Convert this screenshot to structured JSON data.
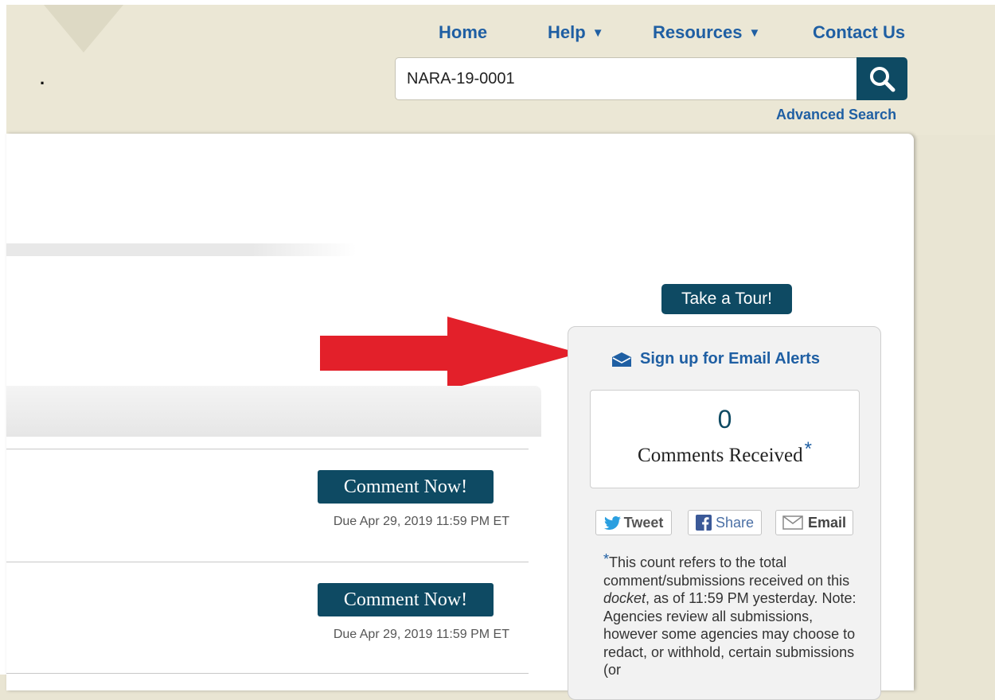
{
  "header": {
    "nav": [
      {
        "label": "Home",
        "dropdown": false
      },
      {
        "label": "Help",
        "dropdown": true
      },
      {
        "label": "Resources",
        "dropdown": true
      },
      {
        "label": "Contact Us",
        "dropdown": false
      }
    ],
    "logo_text": ".",
    "search": {
      "value": "NARA-19-0001",
      "icon": "search-icon"
    },
    "advanced_search": "Advanced Search"
  },
  "main": {
    "comments": [
      {
        "button": "Comment Now!",
        "due": "Due Apr 29, 2019 11:59 PM ET"
      },
      {
        "button": "Comment Now!",
        "due": "Due Apr 29, 2019 11:59 PM ET"
      }
    ]
  },
  "sidebar": {
    "tour_button": "Take a Tour!",
    "email_alert": "Sign up for Email Alerts",
    "comment_count": "0",
    "comment_count_label": "Comments Received",
    "asterisk": "*",
    "share": {
      "tweet": "Tweet",
      "share": "Share",
      "email": "Email"
    },
    "note_star": "*",
    "note_part1": "This count refers to the total comment/submissions received on this ",
    "note_italic": "docket",
    "note_part2": ", as of 11:59 PM yesterday. Note: Agencies review all submissions, however some agencies may choose to redact, or withhold, certain submissions (or"
  },
  "colors": {
    "accent": "#0e4a63",
    "link": "#1f5fa3",
    "header_bg": "#ebe7d5",
    "arrow": "#e3202a"
  }
}
